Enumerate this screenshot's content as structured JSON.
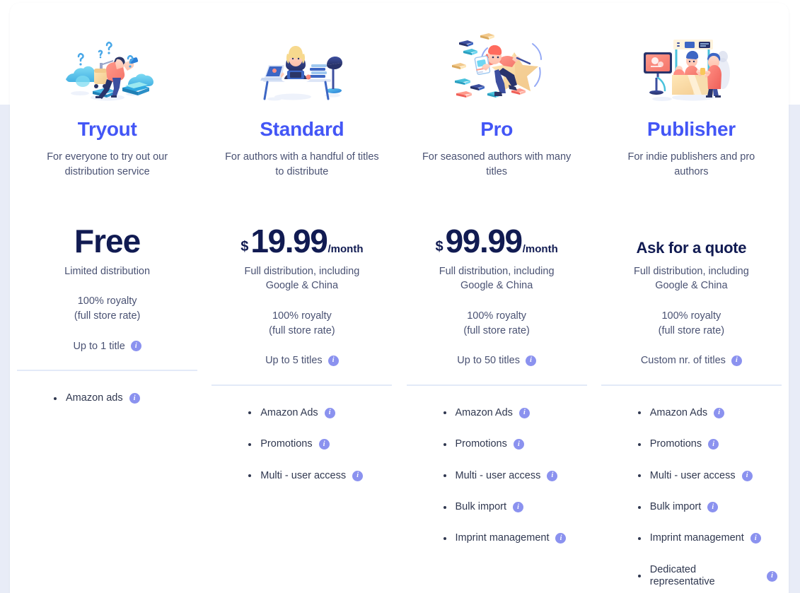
{
  "theme": {
    "accent_blue": "#4356f6",
    "price_navy": "#111b52",
    "body_text": "#4a5273",
    "info_icon": "#8b92ef",
    "divider": "#e3eaf8",
    "page_bg": "#e8ecf7",
    "card_bg": "#ffffff"
  },
  "info_icon_label": "i",
  "plans": [
    {
      "id": "tryout",
      "illustration": "traveler-with-suitcase-questions-illustration",
      "name": "Tryout",
      "tagline": "For everyone to try out our distribution service",
      "price": {
        "type": "free",
        "currency": "",
        "amount": "Free",
        "period": ""
      },
      "core_features": [
        {
          "text": "Limited distribution",
          "info": false
        },
        {
          "text": "100% royalty\n(full store rate)",
          "info": false
        },
        {
          "text": "Up to 1 title",
          "info": true
        }
      ],
      "features": [
        {
          "label": "Amazon ads",
          "info": true
        }
      ]
    },
    {
      "id": "standard",
      "illustration": "author-at-desk-with-laptop-illustration",
      "name": "Standard",
      "tagline": "For authors with a handful of titles to distribute",
      "price": {
        "type": "monthly",
        "currency": "$",
        "amount": "19.99",
        "period": "/month"
      },
      "core_features": [
        {
          "text": "Full distribution, including\nGoogle & China",
          "info": false
        },
        {
          "text": "100% royalty\n(full store rate)",
          "info": false
        },
        {
          "text": "Up to 5 titles",
          "info": true
        }
      ],
      "features": [
        {
          "label": "Amazon Ads",
          "info": true
        },
        {
          "label": "Promotions",
          "info": true
        },
        {
          "label": "Multi - user access",
          "info": true
        }
      ]
    },
    {
      "id": "pro",
      "illustration": "author-flying-with-star-illustration",
      "name": "Pro",
      "tagline": "For seasoned authors with many titles",
      "price": {
        "type": "monthly",
        "currency": "$",
        "amount": "99.99",
        "period": "/month"
      },
      "core_features": [
        {
          "text": "Full distribution, including\nGoogle & China",
          "info": false
        },
        {
          "text": "100% royalty\n(full store rate)",
          "info": false
        },
        {
          "text": "Up to 50 titles",
          "info": true
        }
      ],
      "features": [
        {
          "label": "Amazon Ads",
          "info": true
        },
        {
          "label": "Promotions",
          "info": true
        },
        {
          "label": "Multi - user access",
          "info": true
        },
        {
          "label": "Bulk import",
          "info": true
        },
        {
          "label": "Imprint management",
          "info": true
        }
      ]
    },
    {
      "id": "publisher",
      "illustration": "publisher-booth-with-screen-illustration",
      "name": "Publisher",
      "tagline": "For indie publishers and pro authors",
      "price": {
        "type": "quote",
        "currency": "",
        "amount": "Ask for a quote",
        "period": ""
      },
      "core_features": [
        {
          "text": "Full distribution, including\nGoogle & China",
          "info": false
        },
        {
          "text": "100% royalty\n(full store rate)",
          "info": false
        },
        {
          "text": "Custom nr. of titles",
          "info": true
        }
      ],
      "features": [
        {
          "label": "Amazon Ads",
          "info": true
        },
        {
          "label": "Promotions",
          "info": true
        },
        {
          "label": "Multi - user access",
          "info": true
        },
        {
          "label": "Bulk import",
          "info": true
        },
        {
          "label": "Imprint management",
          "info": true
        },
        {
          "label": "Dedicated representative",
          "info": true
        }
      ]
    }
  ]
}
